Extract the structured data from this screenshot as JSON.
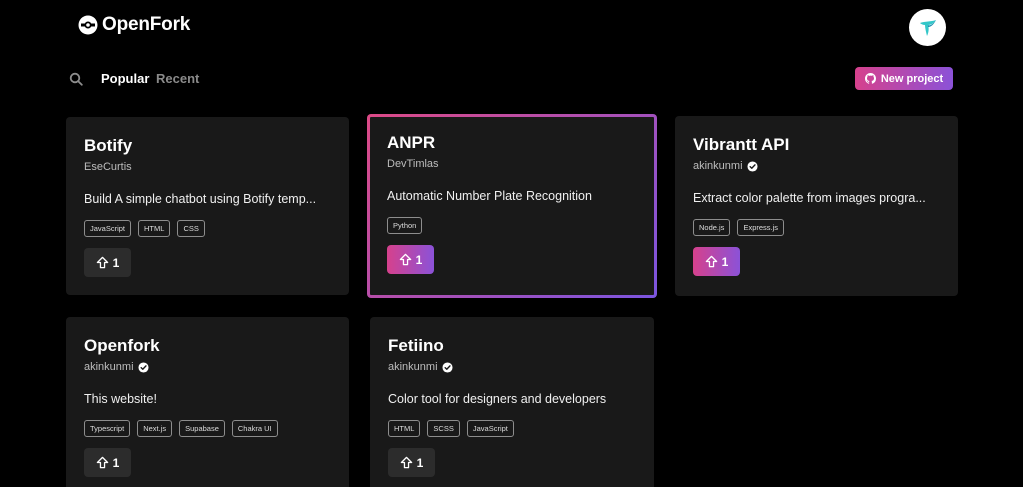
{
  "app": {
    "name": "OpenFork"
  },
  "toolbar": {
    "tabs": [
      "Popular",
      "Recent"
    ],
    "new_project_label": "New project"
  },
  "projects": [
    {
      "title": "Botify",
      "author": "EseCurtis",
      "verified": false,
      "description": "Build A simple chatbot using Botify temp...",
      "tags": [
        "JavaScript",
        "HTML",
        "CSS"
      ],
      "upvotes": "1",
      "upvoted": false
    },
    {
      "title": "ANPR",
      "author": "DevTimlas",
      "verified": false,
      "description": "Automatic Number Plate Recognition",
      "tags": [
        "Python"
      ],
      "upvotes": "1",
      "upvoted": true
    },
    {
      "title": "Vibrantt API",
      "author": "akinkunmi",
      "verified": true,
      "description": "Extract color palette from images progra...",
      "tags": [
        "Node.js",
        "Express.js"
      ],
      "upvotes": "1",
      "upvoted": true
    },
    {
      "title": "Openfork",
      "author": "akinkunmi",
      "verified": true,
      "description": "This website!",
      "tags": [
        "Typescript",
        "Next.js",
        "Supabase",
        "Chakra UI"
      ],
      "upvotes": "1",
      "upvoted": false
    },
    {
      "title": "Fetiino",
      "author": "akinkunmi",
      "verified": true,
      "description": "Color tool for designers and developers",
      "tags": [
        "HTML",
        "SCSS",
        "JavaScript"
      ],
      "upvotes": "1",
      "upvoted": false
    }
  ],
  "colors": {
    "accent_start": "#d6418c",
    "accent_end": "#8b52d8",
    "card_bg": "#191919",
    "page_bg": "#000000"
  }
}
